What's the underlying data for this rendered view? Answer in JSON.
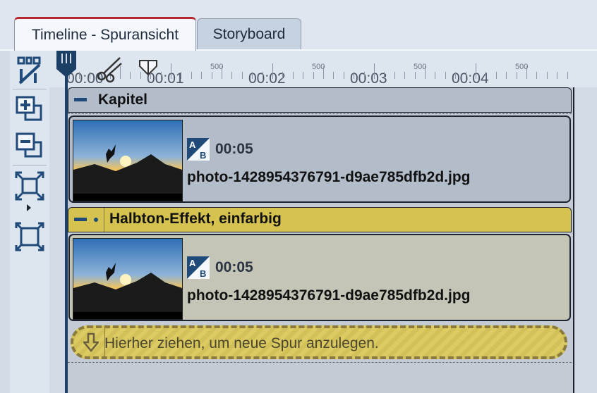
{
  "tabs": [
    {
      "label": "Timeline - Spuransicht",
      "active": true
    },
    {
      "label": "Storyboard",
      "active": false
    }
  ],
  "toolbar": {
    "icons": [
      "magnet-split-icon",
      "add-track-icon",
      "remove-track-icon",
      "zoom-fit-icon",
      "expand-icon"
    ]
  },
  "ruler": {
    "major_labels": [
      "00:00",
      "00:01",
      "00:02",
      "00:03",
      "00:04"
    ],
    "minor_label": "500"
  },
  "chapter": {
    "title": "Kapitel"
  },
  "clips": [
    {
      "duration": "00:05",
      "filename": "photo-1428954376791-d9ae785dfb2d.jpg",
      "ab_label_a": "A",
      "ab_label_b": "B"
    },
    {
      "duration": "00:05",
      "filename": "photo-1428954376791-d9ae785dfb2d.jpg",
      "ab_label_a": "A",
      "ab_label_b": "B"
    }
  ],
  "effect": {
    "title": "Halbton-Effekt, einfarbig"
  },
  "drop_zone": {
    "text": "Hierher ziehen, um neue Spur anzulegen."
  },
  "colors": {
    "accent_tab": "#b3272d",
    "icon_blue": "#1f4a7a",
    "effect_yellow": "#d6c24f",
    "clip_bg_1": "#b3bdca",
    "clip_bg_2": "#c4c5b7"
  }
}
